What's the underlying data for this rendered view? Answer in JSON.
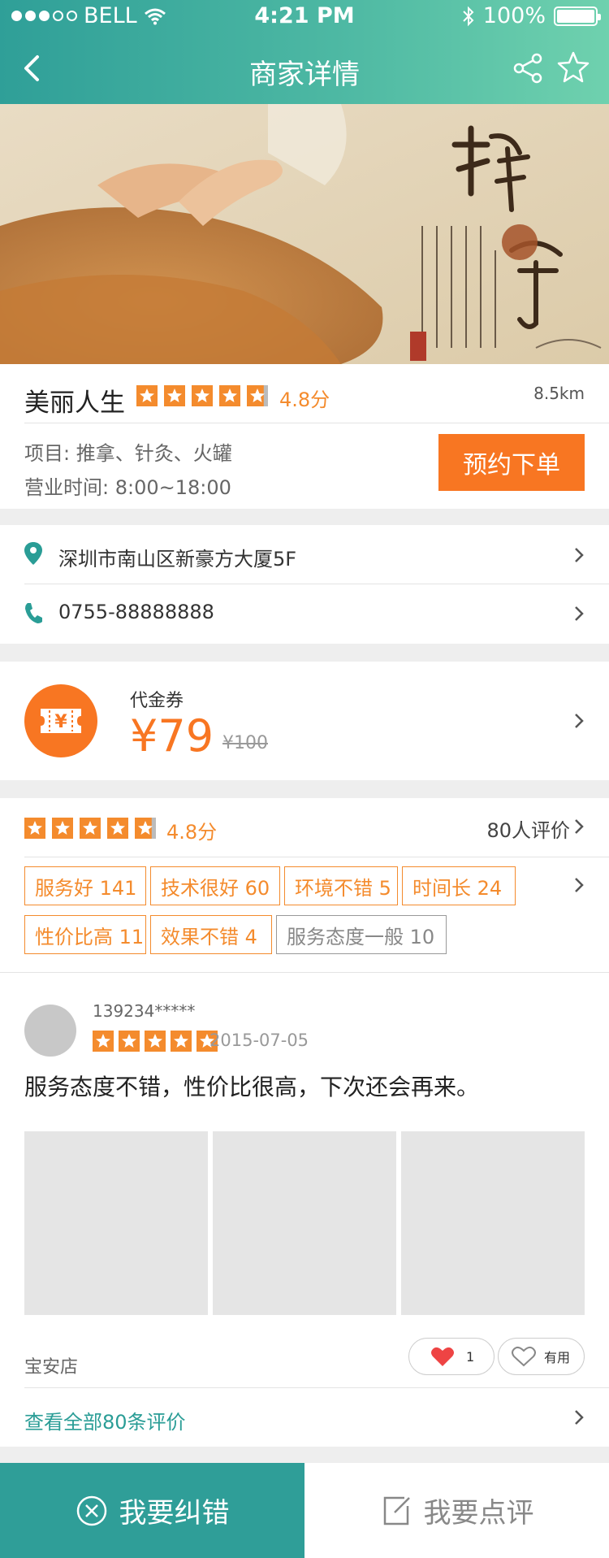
{
  "status_bar": {
    "carrier": "BELL",
    "time": "4:21 PM",
    "battery": "100%",
    "signal_bars_filled": 3,
    "signal_bars_total": 5
  },
  "nav": {
    "title": "商家详情"
  },
  "shop": {
    "name": "美丽人生",
    "rating_text": "4.8分",
    "rating": 4.8,
    "distance": "8.5km",
    "projects_label": "项目:",
    "projects": "推拿、针灸、火罐",
    "hours_label": "营业时间:",
    "hours": "8:00~18:00",
    "book_label": "预约下单"
  },
  "contact": {
    "address": "深圳市南山区新豪方大厦5F",
    "phone": "0755-88888888"
  },
  "coupon": {
    "label": "代金券",
    "price": "¥79",
    "original_price": "¥100",
    "icon_text": "¥"
  },
  "reviews": {
    "rating_text": "4.8分",
    "rating": 4.8,
    "count_label": "80人评价",
    "tags": [
      {
        "label": "服务好 141"
      },
      {
        "label": "技术很好 60"
      },
      {
        "label": "环境不错 5"
      },
      {
        "label": "时间长 24"
      },
      {
        "label": "性价比高 11"
      },
      {
        "label": "效果不错 4"
      },
      {
        "label": "服务态度一般 10"
      }
    ],
    "item": {
      "user": "139234*****",
      "rating": 5,
      "date": "2015-07-05",
      "comment": "服务态度不错，性价比很高，下次还会再来。",
      "store": "宝安店",
      "like_count": "1",
      "useful_label": "有用"
    },
    "view_all": "查看全部80条评价"
  },
  "bottom_bar": {
    "report_label": "我要纠错",
    "review_label": "我要点评"
  },
  "colors": {
    "accent": "#2f9e98",
    "orange": "#f87622",
    "rating": "#f48b2d"
  }
}
